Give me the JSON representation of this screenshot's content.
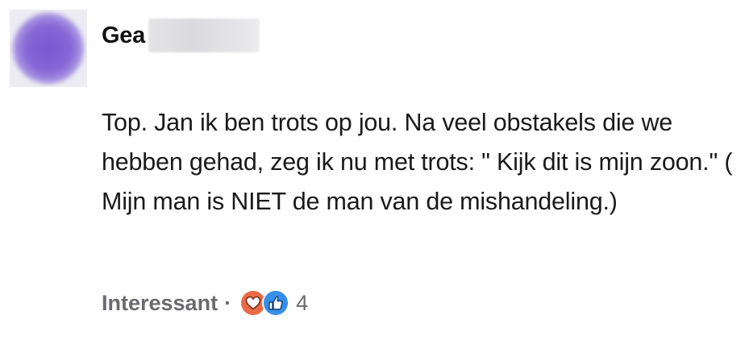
{
  "comment": {
    "author": {
      "name": "Gea",
      "avatar_color": "#8666d6"
    },
    "text": "Top. Jan ik ben trots op jou. Na veel obstakels die we hebben gehad, zeg ik nu met trots: \" Kijk dit is mijn zoon.\" ( Mijn man is NIET de man van de mishandeling.)",
    "footer": {
      "action_label": "Interessant",
      "separator": "·",
      "reactions": [
        {
          "icon": "heart-icon",
          "color": "#e86b47"
        },
        {
          "icon": "thumbs-up-icon",
          "color": "#378fe9"
        }
      ],
      "reaction_count": "4"
    }
  }
}
